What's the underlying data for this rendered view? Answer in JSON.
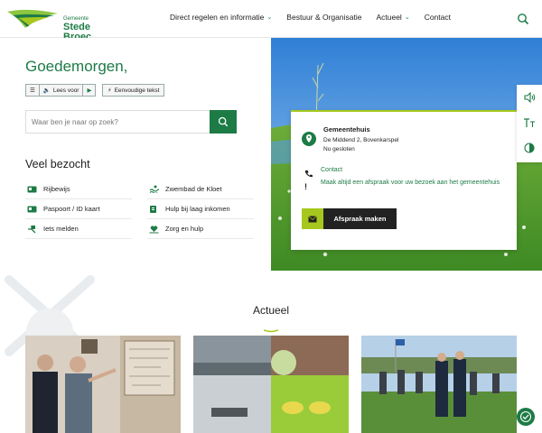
{
  "colors": {
    "brand": "#1d7b46",
    "accent": "#a6c81e"
  },
  "header": {
    "logo_small": "Gemeente",
    "logo_big": "Stede Broec",
    "nav": [
      {
        "label": "Direct regelen en informatie",
        "has_dropdown": true
      },
      {
        "label": "Bestuur & Organisatie",
        "has_dropdown": false
      },
      {
        "label": "Actueel",
        "has_dropdown": true
      },
      {
        "label": "Contact",
        "has_dropdown": false
      }
    ],
    "search_icon": "search-icon"
  },
  "hero": {
    "greeting": "Goedemorgen,",
    "readspeaker_label": "Lees voor",
    "simple_text_label": "Eenvoudige tekst",
    "search_placeholder": "Waar ben je naar op zoek?"
  },
  "veel_bezocht": {
    "title": "Veel bezocht",
    "items": [
      {
        "label": "Rijbewijs",
        "icon": "id-card-icon"
      },
      {
        "label": "Zwembad de Kloet",
        "icon": "swimmer-icon"
      },
      {
        "label": "Paspoort / ID kaart",
        "icon": "id-card-icon"
      },
      {
        "label": "Hulp bij laag inkomen",
        "icon": "coins-icon"
      },
      {
        "label": "Iets melden",
        "icon": "report-icon"
      },
      {
        "label": "Zorg en hulp",
        "icon": "care-icon"
      }
    ]
  },
  "card": {
    "title": "Gemeentehuis",
    "address": "De Middend 2, Bovenkarspel",
    "status": "Nu gesloten",
    "contact_label": "Contact",
    "note": "Maak altijd een afspraak voor uw bezoek aan het gemeentehuis",
    "appointment_label": "Afspraak maken"
  },
  "side_tools": [
    "speaker-icon",
    "text-size-icon",
    "contrast-icon"
  ],
  "actueel": {
    "title": "Actueel"
  }
}
